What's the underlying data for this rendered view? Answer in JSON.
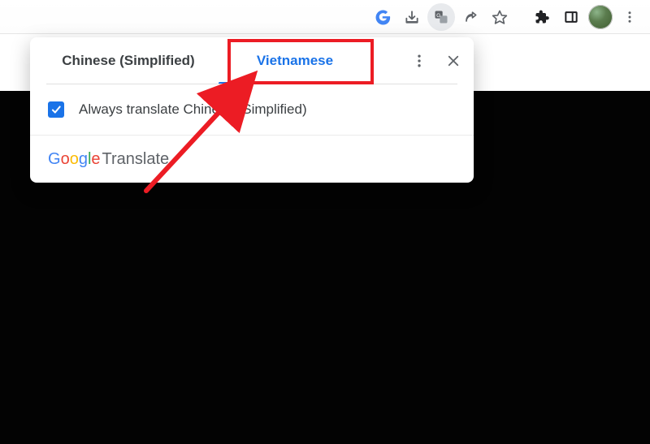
{
  "toolbar": {
    "icons": [
      "google-g",
      "download",
      "translate",
      "share",
      "star",
      "extensions",
      "side-panel",
      "avatar",
      "kebab"
    ]
  },
  "translate_popup": {
    "tabs": {
      "source": "Chinese (Simplified)",
      "target": "Vietnamese",
      "selected": "target"
    },
    "always": {
      "checked": true,
      "label": "Always translate Chinese (Simplified)"
    },
    "footer": {
      "brand": "Google",
      "word": "Translate"
    }
  },
  "annotation": {
    "highlighted_tab": "Vietnamese"
  }
}
